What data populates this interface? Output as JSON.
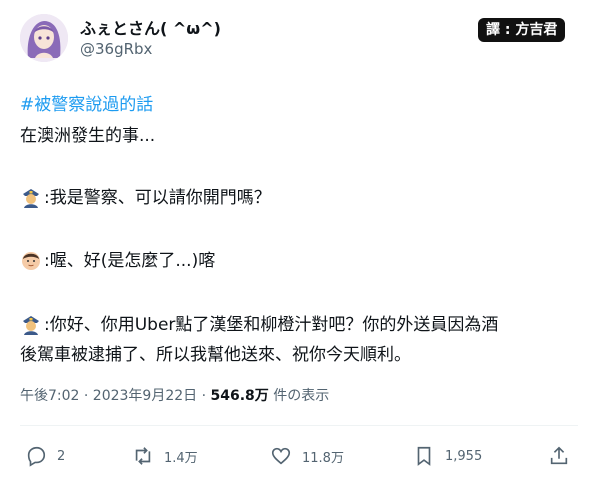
{
  "author": {
    "name": "ふぇとさん( ^ω^)",
    "handle": "@36gRbx"
  },
  "watermark": "譯 : 方吉君",
  "tweet": {
    "hashtag": "#被警察說過的話",
    "lines": [
      "在澳洲發生的事...",
      ":我是警察、可以請你開門嗎？",
      ":喔、好(是怎麼了...)喀",
      ":你好、你用Uber點了漢堡和柳橙汁對吧？你的外送員因為酒",
      "後駕車被逮捕了、所以我幫他送來、祝你今天順利。"
    ],
    "emoji": [
      "police-officer-icon",
      "man-face-icon",
      "police-officer-icon"
    ]
  },
  "meta": {
    "time": "午後7:02 · 2023年9月22日 · ",
    "views": "546.8万",
    "views_label": " 件の表示"
  },
  "actions": {
    "replies": "2",
    "retweets": "1.4万",
    "likes": "11.8万",
    "views": "1,955"
  }
}
